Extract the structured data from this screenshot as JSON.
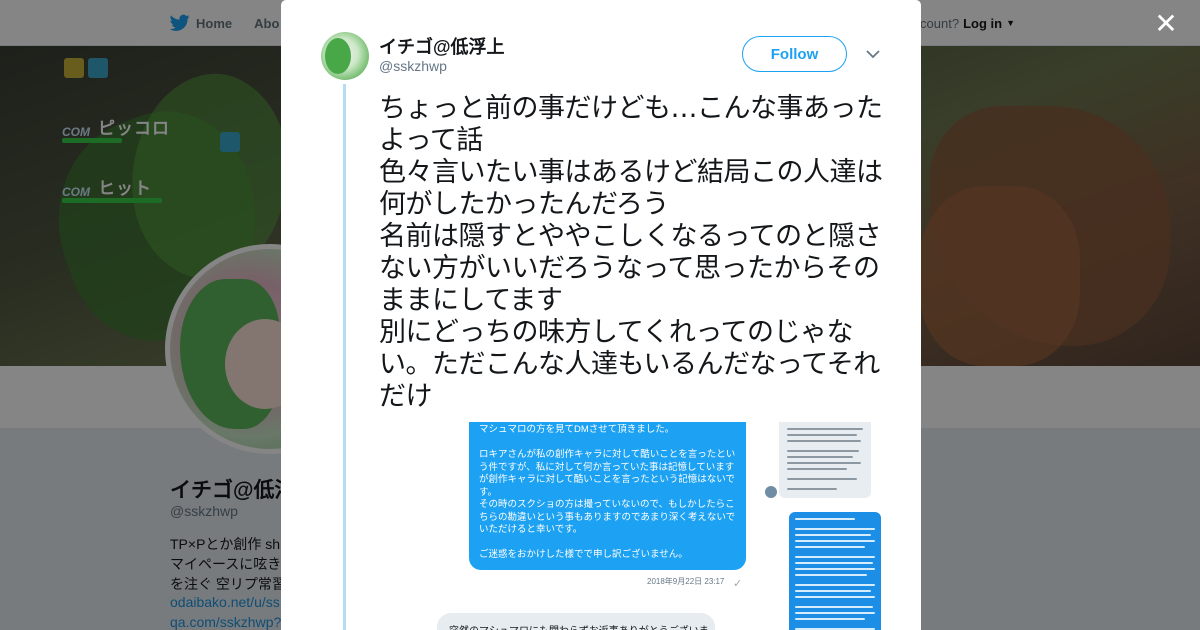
{
  "nav": {
    "home_label": "Home",
    "about_label": "Abo",
    "account_prompt": "ccount?",
    "login_label": "Log in",
    "brand_color": "#1da1f2"
  },
  "banner": {
    "hud": [
      {
        "com": "COM",
        "name": "ピッコロ"
      },
      {
        "com": "COM",
        "name": "ヒット"
      }
    ]
  },
  "profile": {
    "name": "イチゴ@低浮",
    "handle": "@sskzhwp",
    "bio": [
      "TP×Pとか創作 sh",
      "マイペースに呟き",
      "を注ぐ 空リプ常習"
    ],
    "links": [
      "odaibako.net/u/ss",
      "qa.com/sskzhwp?"
    ]
  },
  "tweet": {
    "author_name": "イチゴ@低浮上",
    "author_handle": "@sskzhwp",
    "follow_label": "Follow",
    "text": "ちょっと前の事だけども…こんな事あったよって話\n色々言いたい事はあるけど結局この人達は何がしたかったんだろう\n名前は隠すとややこしくなるってのと隠さない方がいいだろうなって思ったからそのままにしてます\n別にどっちの味方してくれってのじゃない。ただこんな人達もいるんだなってそれだけ",
    "media": {
      "dm_message": "マシュマロの方を見てDMさせて頂きました。\n\nロキアさんが私の創作キャラに対して酷いことを言ったという件ですが、私に対して何か言っていた事は記憶していますが創作キャラに対して酷いことを言ったという記憶はないです。\nその時のスクショの方は撮っていないので、もしかしたらこちらの勘違いという事もありますのであまり深く考えないでいただけると幸いです。\n\nご迷惑をおかけした様でで申し訳ございません。",
      "dm_time": "2018年9月22日 23:17",
      "dm_reply": "突然のマシュマロにも関わらずお返事ありがとうございま"
    }
  }
}
